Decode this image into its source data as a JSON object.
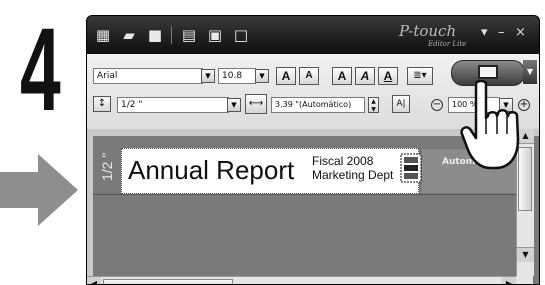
{
  "step": {
    "number": "4"
  },
  "titlebar": {
    "brand": "P-touch",
    "brand_sub": "Editor Lite",
    "icons": [
      "new-label-icon",
      "open-icon",
      "save-icon",
      "text-icon",
      "image-icon",
      "frame-icon"
    ],
    "controls": [
      "▾",
      "–",
      "×"
    ]
  },
  "toolbar": {
    "font_name": "Arial",
    "font_size": "10.8",
    "font_size_up": "A",
    "font_size_down": "A",
    "bold": "A",
    "italic": "A",
    "underline": "A",
    "tape_width": "1/2 \"",
    "label_length": "3.39 \"(Automático)",
    "zoom": "100 %"
  },
  "workspace": {
    "length_label": "1/2 \"",
    "ghost_label": "Automá",
    "label": {
      "main_text": "Annual Report",
      "side_line_1": "Fiscal 2008",
      "side_line_2": "Marketing Dept"
    }
  },
  "colors": {
    "titlebar": "#1e1e1e",
    "toolbar": "#e4e4e4",
    "workspace": "#7a7a7a",
    "arrow": "#8e8e8e"
  }
}
